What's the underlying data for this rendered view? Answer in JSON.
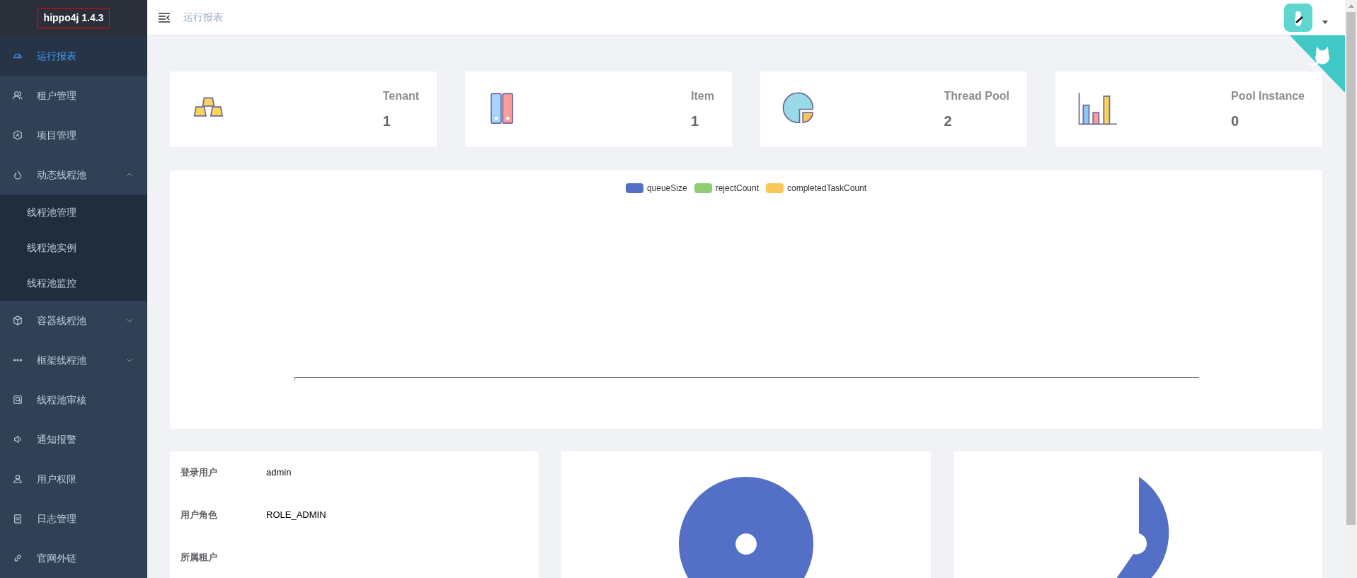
{
  "logo": {
    "title": "hippo4j 1.4.3"
  },
  "sidebar": {
    "items": [
      {
        "label": "运行报表",
        "kind": "link",
        "selected": true
      },
      {
        "label": "租户管理",
        "kind": "link",
        "selected": false
      },
      {
        "label": "项目管理",
        "kind": "link",
        "selected": false
      },
      {
        "label": "动态线程池",
        "kind": "submenu",
        "selected": false,
        "expanded": true,
        "children": [
          {
            "label": "线程池管理",
            "selected": false
          },
          {
            "label": "线程池实例",
            "selected": false
          },
          {
            "label": "线程池监控",
            "selected": false
          }
        ]
      },
      {
        "label": "容器线程池",
        "kind": "submenu",
        "selected": false,
        "expanded": false
      },
      {
        "label": "框架线程池",
        "kind": "submenu",
        "selected": false,
        "expanded": false
      },
      {
        "label": "线程池审核",
        "kind": "link",
        "selected": false
      },
      {
        "label": "通知报警",
        "kind": "link",
        "selected": false
      },
      {
        "label": "用户权限",
        "kind": "link",
        "selected": false
      },
      {
        "label": "日志管理",
        "kind": "link",
        "selected": false
      },
      {
        "label": "官网外链",
        "kind": "link",
        "selected": false
      }
    ]
  },
  "header": {
    "breadcrumb": "运行报表"
  },
  "stats": [
    {
      "label": "Tenant",
      "value": "1"
    },
    {
      "label": "Item",
      "value": "1"
    },
    {
      "label": "Thread Pool",
      "value": "2"
    },
    {
      "label": "Pool Instance",
      "value": "0"
    }
  ],
  "line_chart": {
    "legend": [
      {
        "label": "queueSize",
        "color": "#5470c6"
      },
      {
        "label": "rejectCount",
        "color": "#91cc75"
      },
      {
        "label": "completedTaskCount",
        "color": "#fac858"
      }
    ]
  },
  "user_info": [
    {
      "label": "登录用户",
      "value": "admin"
    },
    {
      "label": "用户角色",
      "value": "ROLE_ADMIN"
    },
    {
      "label": "所属租户"
    }
  ]
}
